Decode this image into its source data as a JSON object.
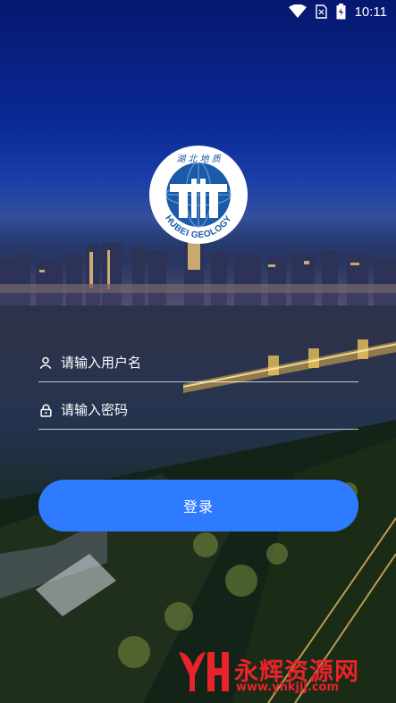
{
  "status_bar": {
    "time": "10:11",
    "icons": [
      "wifi-icon",
      "sim-card-icon",
      "battery-icon"
    ]
  },
  "logo": {
    "top_text": "湖 北 地 质",
    "bottom_text": "HUBEI GEOLOGY"
  },
  "form": {
    "username_placeholder": "请输入用户名",
    "password_placeholder": "请输入密码",
    "login_label": "登录"
  },
  "watermark": {
    "title": "永辉资源网",
    "url": "www.yhkjjj.com"
  },
  "colors": {
    "accent": "#2f7bff",
    "watermark": "#e8232b",
    "text": "#ffffff"
  }
}
